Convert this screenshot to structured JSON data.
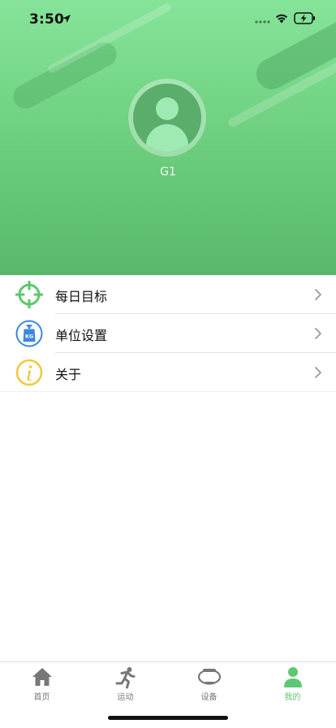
{
  "status_bar": {
    "time": "3:50"
  },
  "profile": {
    "username": "G1"
  },
  "menu": {
    "items": [
      {
        "label": "每日目标",
        "icon": "target-icon"
      },
      {
        "label": "单位设置",
        "icon": "kg-weight-icon"
      },
      {
        "label": "关于",
        "icon": "info-icon"
      }
    ]
  },
  "tabbar": {
    "tabs": [
      {
        "label": "首页",
        "icon": "home-icon"
      },
      {
        "label": "运动",
        "icon": "running-icon"
      },
      {
        "label": "设备",
        "icon": "band-icon"
      },
      {
        "label": "我的",
        "icon": "person-icon"
      }
    ],
    "active_index": 3
  },
  "colors": {
    "header_top": "#86e49a",
    "header_bottom": "#59b86b",
    "accent": "#5fc873",
    "target": "#5cc86a",
    "kg_blue": "#3a86e0",
    "info_yellow": "#f0c83c"
  }
}
